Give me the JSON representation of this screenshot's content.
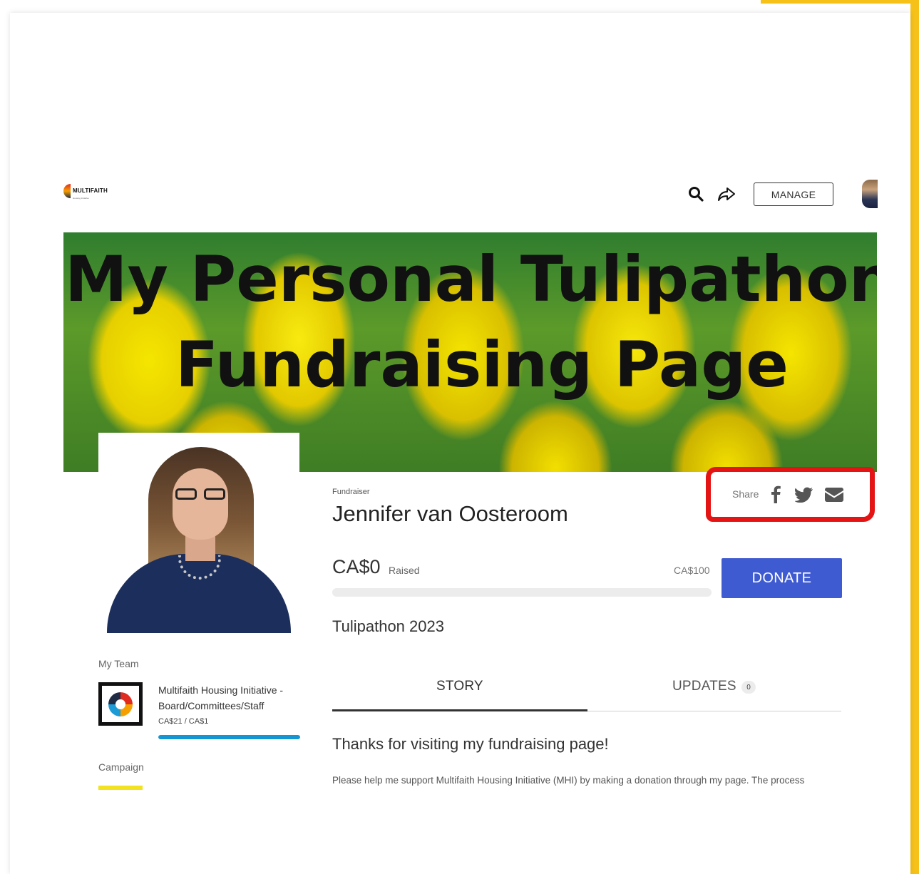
{
  "colors": {
    "accent": "#3f5bd1",
    "highlight": "#e41414",
    "edge": "#f6c21a",
    "team_bar": "#1596d2"
  },
  "header": {
    "logo_text": "MULTIFAITH",
    "logo_subtext": "Housing Initiative",
    "manage_label": "MANAGE",
    "icons": [
      "search-icon",
      "share-arrow-icon"
    ]
  },
  "banner": {
    "line1": "My Personal Tulipathon",
    "line2": "Fundraising Page"
  },
  "fundraiser": {
    "label": "Fundraiser",
    "name": "Jennifer van Oosteroom",
    "share_label": "Share",
    "share_icons": [
      "facebook-icon",
      "twitter-icon",
      "mail-icon"
    ],
    "raised": "CA$0",
    "raised_label": "Raised",
    "goal": "CA$100",
    "progress_fraction": 0,
    "donate_label": "DONATE",
    "campaign": "Tulipathon 2023"
  },
  "tabs": {
    "story": "STORY",
    "updates": "UPDATES",
    "updates_count": "0",
    "active": "story"
  },
  "story": {
    "heading": "Thanks for visiting my fundraising page!",
    "text": "Please help me support Multifaith Housing Initiative (MHI) by making a donation through my page. The process"
  },
  "sidebar": {
    "team_label": "My Team",
    "team_name": "Multifaith Housing Initiative - Board/Committees/Staff",
    "team_amount": "CA$21 / CA$1",
    "team_progress_fraction": 1,
    "campaign_label": "Campaign"
  }
}
